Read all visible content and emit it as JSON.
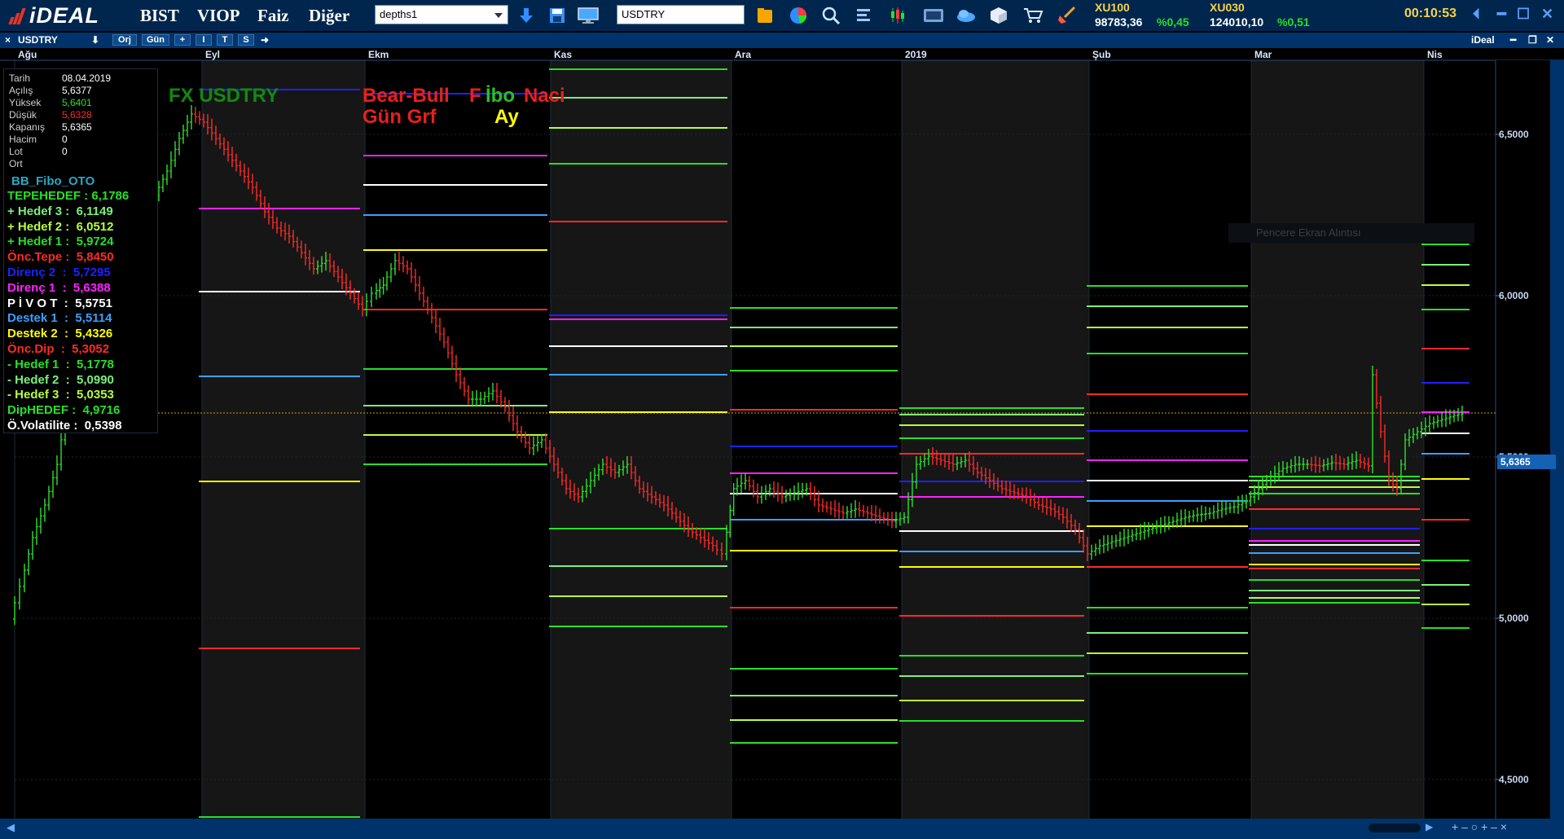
{
  "app": {
    "logo_text": "iDEAL",
    "menu": [
      "BIST",
      "VIOP",
      "Faiz",
      "Diğer"
    ],
    "layout_combo": "depths1",
    "symbol_field": "USDTRY",
    "indices": [
      {
        "name": "XU100",
        "value": "98783,36",
        "change": "%0,45"
      },
      {
        "name": "XU030",
        "value": "124010,10",
        "change": "%0,51"
      }
    ],
    "clock": "00:10:53",
    "icons": [
      "download-arrow-icon",
      "save-icon",
      "monitor-icon",
      "folder-icon",
      "pie-chart-icon",
      "search-icon",
      "list-icon",
      "candles-icon",
      "screen-icon",
      "cloud-icon",
      "cube-icon",
      "cart-icon",
      "broom-icon"
    ]
  },
  "chart_toolbar": {
    "close": "×",
    "symbol": "USDTRY",
    "buttons": [
      "Orj",
      "Gün",
      "+",
      "I",
      "T",
      "S"
    ],
    "brand": "iDeal"
  },
  "chart": {
    "title_left": "FX USDTRY",
    "title_mid1": "Bear-Bull",
    "title_mid2": "Gün Grf",
    "title_fibo_f": "F",
    "title_fibo": "İbo Naci",
    "title_ay": "Ay",
    "tooltip": "Pencere Ekran Alıntısı",
    "last_price": "5,6365",
    "y_ticks": [
      "6,5000",
      "6,0000",
      "5,5000",
      "5,0000",
      "4,5000"
    ],
    "months": [
      "Ağu",
      "Eyl",
      "Ekm",
      "Kas",
      "Ara",
      "2019",
      "Şub",
      "Mar",
      "Nis"
    ],
    "colors": {
      "up": "#2ee02e",
      "down": "#ff2a2a",
      "shade": "#161616",
      "axis_bg": "#00336b"
    }
  },
  "info": {
    "ohlc": [
      {
        "k": "Tarih",
        "v": "08.04.2019",
        "c": "#ffffff"
      },
      {
        "k": "Açılış",
        "v": "5,6377",
        "c": "#ffffff"
      },
      {
        "k": "Yüksek",
        "v": "5,6401",
        "c": "#27e027"
      },
      {
        "k": "Düşük",
        "v": "5,6328",
        "c": "#ff2a2a"
      },
      {
        "k": "Kapanış",
        "v": "5,6365",
        "c": "#ffffff"
      },
      {
        "k": "Hacim",
        "v": "0",
        "c": "#ffffff"
      },
      {
        "k": "Lot",
        "v": "0",
        "c": "#ffffff"
      },
      {
        "k": "Ort",
        "v": "",
        "c": "#ffffff"
      }
    ],
    "bb_title": "BB_Fibo_OTO",
    "levels": [
      {
        "label": "TEPEHEDEF : ",
        "value": "6,1786",
        "color": "#27e027"
      },
      {
        "label": "+ Hedef 3 :  ",
        "value": "6,1149",
        "color": "#7bf07b"
      },
      {
        "label": "+ Hedef 2 :  ",
        "value": "6,0512",
        "color": "#b8ff3c"
      },
      {
        "label": "+ Hedef 1 :  ",
        "value": "5,9724",
        "color": "#27e027"
      },
      {
        "label": "Önc.Tepe :  ",
        "value": "5,8450",
        "color": "#ff2a2a"
      },
      {
        "label": "Direnç 2  :  ",
        "value": "5,7295",
        "color": "#2020ff"
      },
      {
        "label": "Direnç 1  :  ",
        "value": "5,6388",
        "color": "#ff20ff"
      },
      {
        "label": "P İ V O T  :  ",
        "value": "5,5751",
        "color": "#ffffff"
      },
      {
        "label": "Destek 1  :  ",
        "value": "5,5114",
        "color": "#3aa0ff"
      },
      {
        "label": "Destek 2  :  ",
        "value": "5,4326",
        "color": "#ffff00"
      },
      {
        "label": "Önc.Dip  :  ",
        "value": "5,3052",
        "color": "#ff2a2a"
      },
      {
        "label": "- Hedef 1  :  ",
        "value": "5,1778",
        "color": "#27e027"
      },
      {
        "label": "- Hedef 2  :  ",
        "value": "5,0990",
        "color": "#7bf07b"
      },
      {
        "label": "- Hedef 3  :  ",
        "value": "5,0353",
        "color": "#b8ff3c"
      },
      {
        "label": "DipHEDEF :  ",
        "value": "4,9716",
        "color": "#27e027"
      },
      {
        "label": "Ö.Volatilite :  ",
        "value": "0,5398",
        "color": "#ffffff"
      }
    ]
  }
}
